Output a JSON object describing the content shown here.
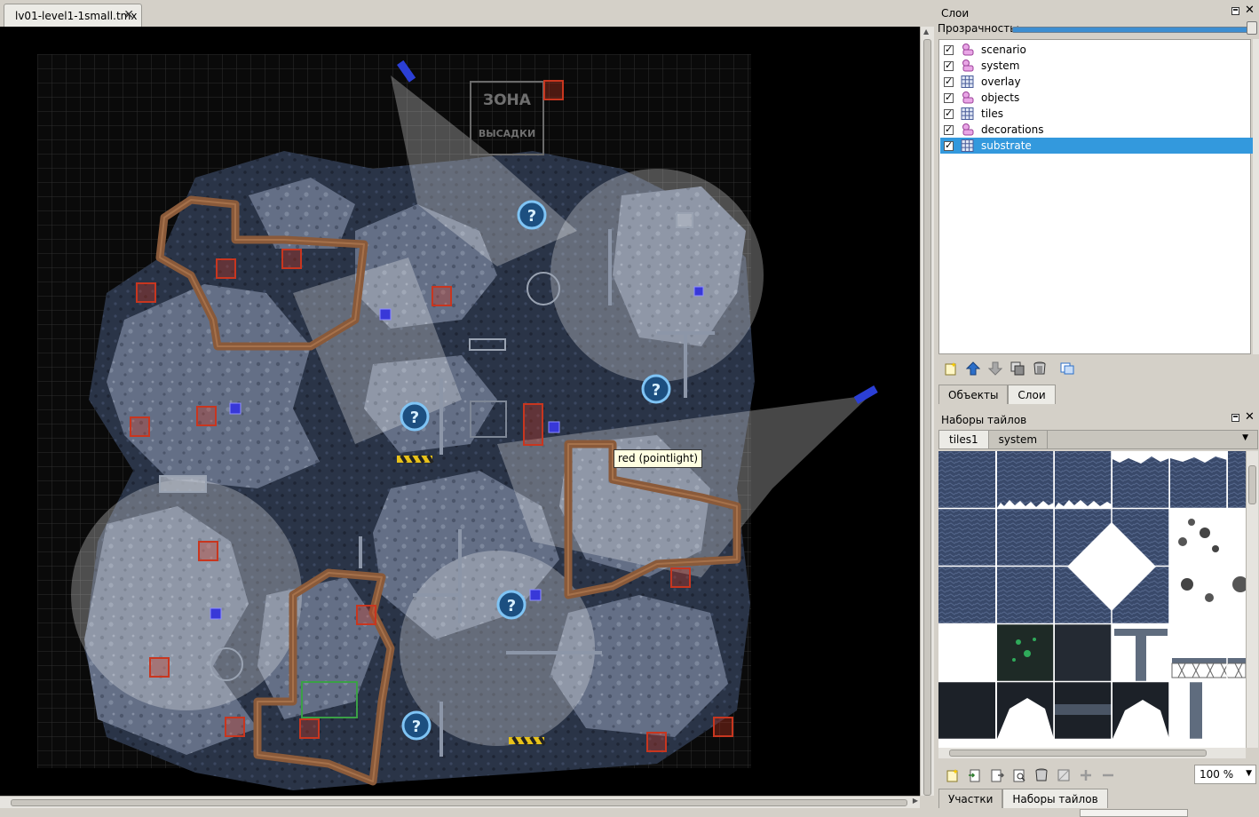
{
  "document": {
    "tab_title": "lv01-level1-1small.tmx",
    "close_icon": "close-icon"
  },
  "map": {
    "tooltip": "red (pointlight)",
    "sign_line1": "ЗОНА",
    "sign_line2": "ВЫСАДКИ"
  },
  "layers_panel": {
    "title": "Слои",
    "opacity_label": "Прозрачность:",
    "opacity_value": 1.0,
    "layers": [
      {
        "name": "scenario",
        "visible": true,
        "type": "object",
        "icon": "object-layer-icon"
      },
      {
        "name": "system",
        "visible": true,
        "type": "object",
        "icon": "object-layer-icon"
      },
      {
        "name": "overlay",
        "visible": true,
        "type": "tile",
        "icon": "tile-layer-icon"
      },
      {
        "name": "objects",
        "visible": true,
        "type": "object",
        "icon": "object-layer-icon"
      },
      {
        "name": "tiles",
        "visible": true,
        "type": "tile",
        "icon": "tile-layer-icon"
      },
      {
        "name": "decorations",
        "visible": true,
        "type": "object",
        "icon": "object-layer-icon"
      },
      {
        "name": "substrate",
        "visible": true,
        "type": "tile",
        "icon": "tile-layer-icon",
        "selected": true
      }
    ],
    "toolbar_icons": [
      "new-layer-icon",
      "move-up-icon",
      "move-down-icon",
      "duplicate-layer-icon",
      "delete-layer-icon",
      "layer-properties-icon"
    ],
    "tabs": [
      "Объекты",
      "Слои"
    ],
    "active_tab": "Слои"
  },
  "tilesets_panel": {
    "title": "Наборы тайлов",
    "tabs": [
      "tiles1",
      "system"
    ],
    "active_tab": "tiles1",
    "toolbar_icons": [
      "new-tileset-icon",
      "import-tileset-icon",
      "export-tileset-icon",
      "tileset-properties-icon",
      "delete-tileset-icon",
      "edit-terrain-icon",
      "add-tiles-icon",
      "remove-tiles-icon"
    ],
    "zoom": "100 %"
  },
  "bottom_tabs": [
    "Участки",
    "Наборы тайлов"
  ],
  "active_bottom_tab": "Наборы тайлов",
  "colors": {
    "selection": "#3399dd",
    "map_background": "#000000",
    "rock": "#5c6a82",
    "pipe": "#8a5a3a",
    "marker_red": "#c8361f",
    "question_blue": "#3aa0e0"
  }
}
